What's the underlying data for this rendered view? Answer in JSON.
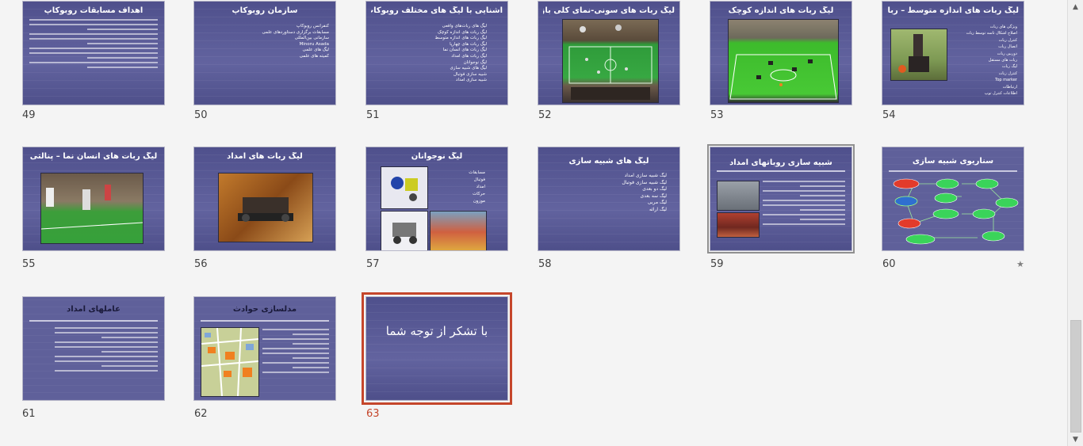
{
  "slides": [
    {
      "num": "49",
      "title": "اهداف مسابقات روبوکاپ"
    },
    {
      "num": "50",
      "title": "سازمان روبوکاپ",
      "bullets": [
        "کنفرانس روبوکاپ",
        "مسابقات برگزاری دستاوردهای علمی",
        "سازمانی بین‌المللی",
        "Minoru Asada",
        "لیگ های علمی",
        "کمیته های علمی"
      ]
    },
    {
      "num": "51",
      "title": "آشنایی با لیگ های مختلف روبوکاپ",
      "bullets": [
        "لیگ های ربات‌های واقعی",
        "لیگ ربات های اندازه کوچک",
        "لیگ ربات های اندازه متوسط",
        "لیگ ربات های چهارپا",
        "لیگ ربات های انسان نما",
        "لیگ ربات های امداد",
        "لیگ نوجوانان",
        "لیگ های شبیه سازی",
        "شبیه سازی فوتبال",
        "شبیه سازی امداد"
      ]
    },
    {
      "num": "52",
      "title": "لیگ ربات های سونی-نمای کلی بازی"
    },
    {
      "num": "53",
      "title": "لیگ ربات های اندازه کوچک"
    },
    {
      "num": "54",
      "title": "لیگ ربات های اندازه متوسط – ربات",
      "bullets": [
        "ویژگی های ربات",
        "اصلاح اشکال تاسه توسط ربات",
        "کنترل ربات",
        "اتصال ربات",
        "دوربین ربات",
        "ربات های مستقل",
        "لیگ ربات",
        "کنترل ربات",
        "Top marker",
        "ارتباطات",
        "اطلاعات کنترل توپ"
      ]
    },
    {
      "num": "55",
      "title": "لیگ ربات های انسان نما – پنالتی"
    },
    {
      "num": "56",
      "title": "لیگ ربات های امداد"
    },
    {
      "num": "57",
      "title": "لیگ نوجوانان",
      "bullets": [
        "مسابقات",
        "فوتبال",
        "امداد",
        "حرکات",
        "موزون"
      ]
    },
    {
      "num": "58",
      "title": "لیگ های شبیه سازی",
      "bullets": [
        "لیگ شبیه سازی امداد",
        "لیگ شبیه سازی فوتبال",
        "لیگ دو بعدی",
        "لیگ سه بعدی",
        "لیگ مربی",
        "لیگ ارائه"
      ]
    },
    {
      "num": "59",
      "title": "شبیه سازی روباتهای امداد"
    },
    {
      "num": "60",
      "title": "سناریوی شبیه سازی",
      "star": "★"
    },
    {
      "num": "61",
      "title": "عاملهای امداد"
    },
    {
      "num": "62",
      "title": "مدلسازی حوادث"
    },
    {
      "num": "63",
      "title": "با تشکر از توجه شما"
    }
  ],
  "colors": {
    "selected": "#c5462b",
    "slide_bg": "#5c5d98",
    "green_field": "#2fb52f"
  }
}
